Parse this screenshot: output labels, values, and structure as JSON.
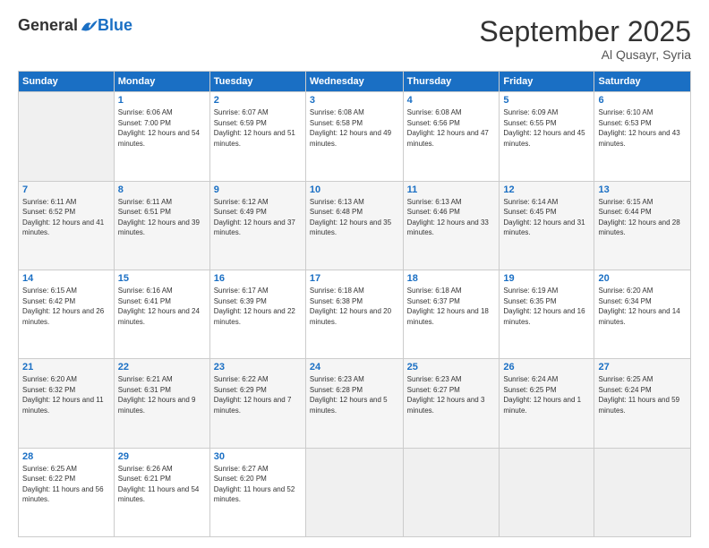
{
  "logo": {
    "general": "General",
    "blue": "Blue"
  },
  "title": "September 2025",
  "location": "Al Qusayr, Syria",
  "days_of_week": [
    "Sunday",
    "Monday",
    "Tuesday",
    "Wednesday",
    "Thursday",
    "Friday",
    "Saturday"
  ],
  "weeks": [
    [
      {
        "day": "",
        "sunrise": "",
        "sunset": "",
        "daylight": ""
      },
      {
        "day": "1",
        "sunrise": "6:06 AM",
        "sunset": "7:00 PM",
        "daylight": "12 hours and 54 minutes."
      },
      {
        "day": "2",
        "sunrise": "6:07 AM",
        "sunset": "6:59 PM",
        "daylight": "12 hours and 51 minutes."
      },
      {
        "day": "3",
        "sunrise": "6:08 AM",
        "sunset": "6:58 PM",
        "daylight": "12 hours and 49 minutes."
      },
      {
        "day": "4",
        "sunrise": "6:08 AM",
        "sunset": "6:56 PM",
        "daylight": "12 hours and 47 minutes."
      },
      {
        "day": "5",
        "sunrise": "6:09 AM",
        "sunset": "6:55 PM",
        "daylight": "12 hours and 45 minutes."
      },
      {
        "day": "6",
        "sunrise": "6:10 AM",
        "sunset": "6:53 PM",
        "daylight": "12 hours and 43 minutes."
      }
    ],
    [
      {
        "day": "7",
        "sunrise": "6:11 AM",
        "sunset": "6:52 PM",
        "daylight": "12 hours and 41 minutes."
      },
      {
        "day": "8",
        "sunrise": "6:11 AM",
        "sunset": "6:51 PM",
        "daylight": "12 hours and 39 minutes."
      },
      {
        "day": "9",
        "sunrise": "6:12 AM",
        "sunset": "6:49 PM",
        "daylight": "12 hours and 37 minutes."
      },
      {
        "day": "10",
        "sunrise": "6:13 AM",
        "sunset": "6:48 PM",
        "daylight": "12 hours and 35 minutes."
      },
      {
        "day": "11",
        "sunrise": "6:13 AM",
        "sunset": "6:46 PM",
        "daylight": "12 hours and 33 minutes."
      },
      {
        "day": "12",
        "sunrise": "6:14 AM",
        "sunset": "6:45 PM",
        "daylight": "12 hours and 31 minutes."
      },
      {
        "day": "13",
        "sunrise": "6:15 AM",
        "sunset": "6:44 PM",
        "daylight": "12 hours and 28 minutes."
      }
    ],
    [
      {
        "day": "14",
        "sunrise": "6:15 AM",
        "sunset": "6:42 PM",
        "daylight": "12 hours and 26 minutes."
      },
      {
        "day": "15",
        "sunrise": "6:16 AM",
        "sunset": "6:41 PM",
        "daylight": "12 hours and 24 minutes."
      },
      {
        "day": "16",
        "sunrise": "6:17 AM",
        "sunset": "6:39 PM",
        "daylight": "12 hours and 22 minutes."
      },
      {
        "day": "17",
        "sunrise": "6:18 AM",
        "sunset": "6:38 PM",
        "daylight": "12 hours and 20 minutes."
      },
      {
        "day": "18",
        "sunrise": "6:18 AM",
        "sunset": "6:37 PM",
        "daylight": "12 hours and 18 minutes."
      },
      {
        "day": "19",
        "sunrise": "6:19 AM",
        "sunset": "6:35 PM",
        "daylight": "12 hours and 16 minutes."
      },
      {
        "day": "20",
        "sunrise": "6:20 AM",
        "sunset": "6:34 PM",
        "daylight": "12 hours and 14 minutes."
      }
    ],
    [
      {
        "day": "21",
        "sunrise": "6:20 AM",
        "sunset": "6:32 PM",
        "daylight": "12 hours and 11 minutes."
      },
      {
        "day": "22",
        "sunrise": "6:21 AM",
        "sunset": "6:31 PM",
        "daylight": "12 hours and 9 minutes."
      },
      {
        "day": "23",
        "sunrise": "6:22 AM",
        "sunset": "6:29 PM",
        "daylight": "12 hours and 7 minutes."
      },
      {
        "day": "24",
        "sunrise": "6:23 AM",
        "sunset": "6:28 PM",
        "daylight": "12 hours and 5 minutes."
      },
      {
        "day": "25",
        "sunrise": "6:23 AM",
        "sunset": "6:27 PM",
        "daylight": "12 hours and 3 minutes."
      },
      {
        "day": "26",
        "sunrise": "6:24 AM",
        "sunset": "6:25 PM",
        "daylight": "12 hours and 1 minute."
      },
      {
        "day": "27",
        "sunrise": "6:25 AM",
        "sunset": "6:24 PM",
        "daylight": "11 hours and 59 minutes."
      }
    ],
    [
      {
        "day": "28",
        "sunrise": "6:25 AM",
        "sunset": "6:22 PM",
        "daylight": "11 hours and 56 minutes."
      },
      {
        "day": "29",
        "sunrise": "6:26 AM",
        "sunset": "6:21 PM",
        "daylight": "11 hours and 54 minutes."
      },
      {
        "day": "30",
        "sunrise": "6:27 AM",
        "sunset": "6:20 PM",
        "daylight": "11 hours and 52 minutes."
      },
      {
        "day": "",
        "sunrise": "",
        "sunset": "",
        "daylight": ""
      },
      {
        "day": "",
        "sunrise": "",
        "sunset": "",
        "daylight": ""
      },
      {
        "day": "",
        "sunrise": "",
        "sunset": "",
        "daylight": ""
      },
      {
        "day": "",
        "sunrise": "",
        "sunset": "",
        "daylight": ""
      }
    ]
  ],
  "labels": {
    "sunrise_prefix": "Sunrise: ",
    "sunset_prefix": "Sunset: ",
    "daylight_prefix": "Daylight: "
  }
}
